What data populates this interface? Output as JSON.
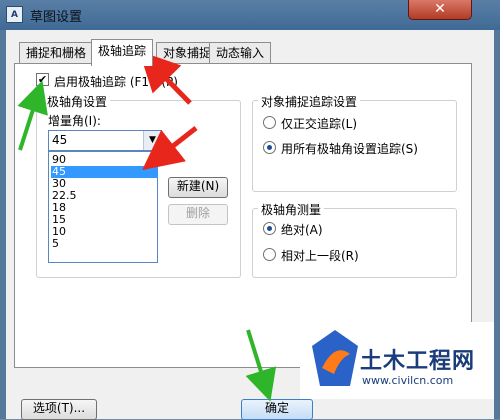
{
  "window": {
    "title": "草图设置",
    "app_icon": "autocad-icon",
    "close_glyph": "✕"
  },
  "tabs": [
    {
      "label": "捕捉和栅格",
      "active": false
    },
    {
      "label": "极轴追踪",
      "active": true
    },
    {
      "label": "对象捕捉",
      "active": false
    },
    {
      "label": "动态输入",
      "active": false
    }
  ],
  "polar": {
    "enable_label": "启用极轴追踪 (F10)(P)",
    "enabled": true,
    "angle_group_title": "极轴角设置",
    "increment_label": "增量角(I):",
    "increment_value": "45",
    "increment_options": [
      "90",
      "45",
      "30",
      "22.5",
      "18",
      "15",
      "10",
      "5"
    ],
    "selected_option": "45",
    "new_button": "新建(N)",
    "delete_button": "删除"
  },
  "osnap_tracking": {
    "title": "对象捕捉追踪设置",
    "option_orthogonal": "仅正交追踪(L)",
    "option_all_polar": "用所有极轴角设置追踪(S)",
    "selected": "option_all_polar"
  },
  "polar_measure": {
    "title": "极轴角测量",
    "option_absolute": "绝对(A)",
    "option_relative": "相对上一段(R)",
    "selected": "option_absolute"
  },
  "footer": {
    "options_button": "选项(T)...",
    "ok_button": "确定"
  },
  "annotation_color": "#e8261c",
  "annotation_green": "#2fb52a",
  "watermark": {
    "text": "土木工程网",
    "url": "www.civilcn.com"
  }
}
